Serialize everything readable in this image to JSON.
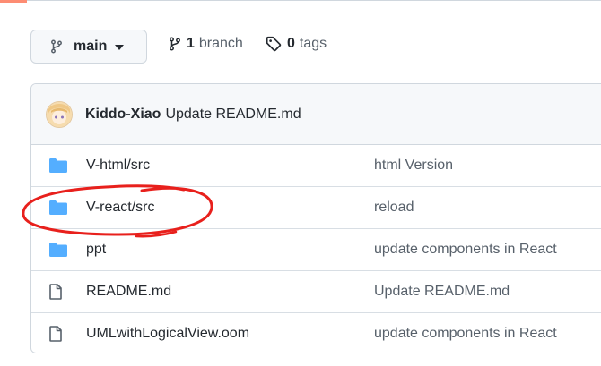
{
  "branch_selector": {
    "label": "main"
  },
  "branches": {
    "count": "1",
    "label": "branch"
  },
  "tags": {
    "count": "0",
    "label": "tags"
  },
  "latest_commit": {
    "author": "Kiddo-Xiao",
    "message": "Update README.md"
  },
  "files": [
    {
      "name": "V-html/src",
      "type": "folder",
      "commit_message": "html Version"
    },
    {
      "name": "V-react/src",
      "type": "folder",
      "commit_message": "reload"
    },
    {
      "name": "ppt",
      "type": "folder",
      "commit_message": "update components in React"
    },
    {
      "name": "README.md",
      "type": "file",
      "commit_message": "Update README.md"
    },
    {
      "name": "UMLwithLogicalView.oom",
      "type": "file",
      "commit_message": "update components in React"
    }
  ],
  "colors": {
    "folder": "#54aeff",
    "file_icon": "#57606a",
    "annotation": "#e8201c",
    "accent": "#fd8c73"
  }
}
